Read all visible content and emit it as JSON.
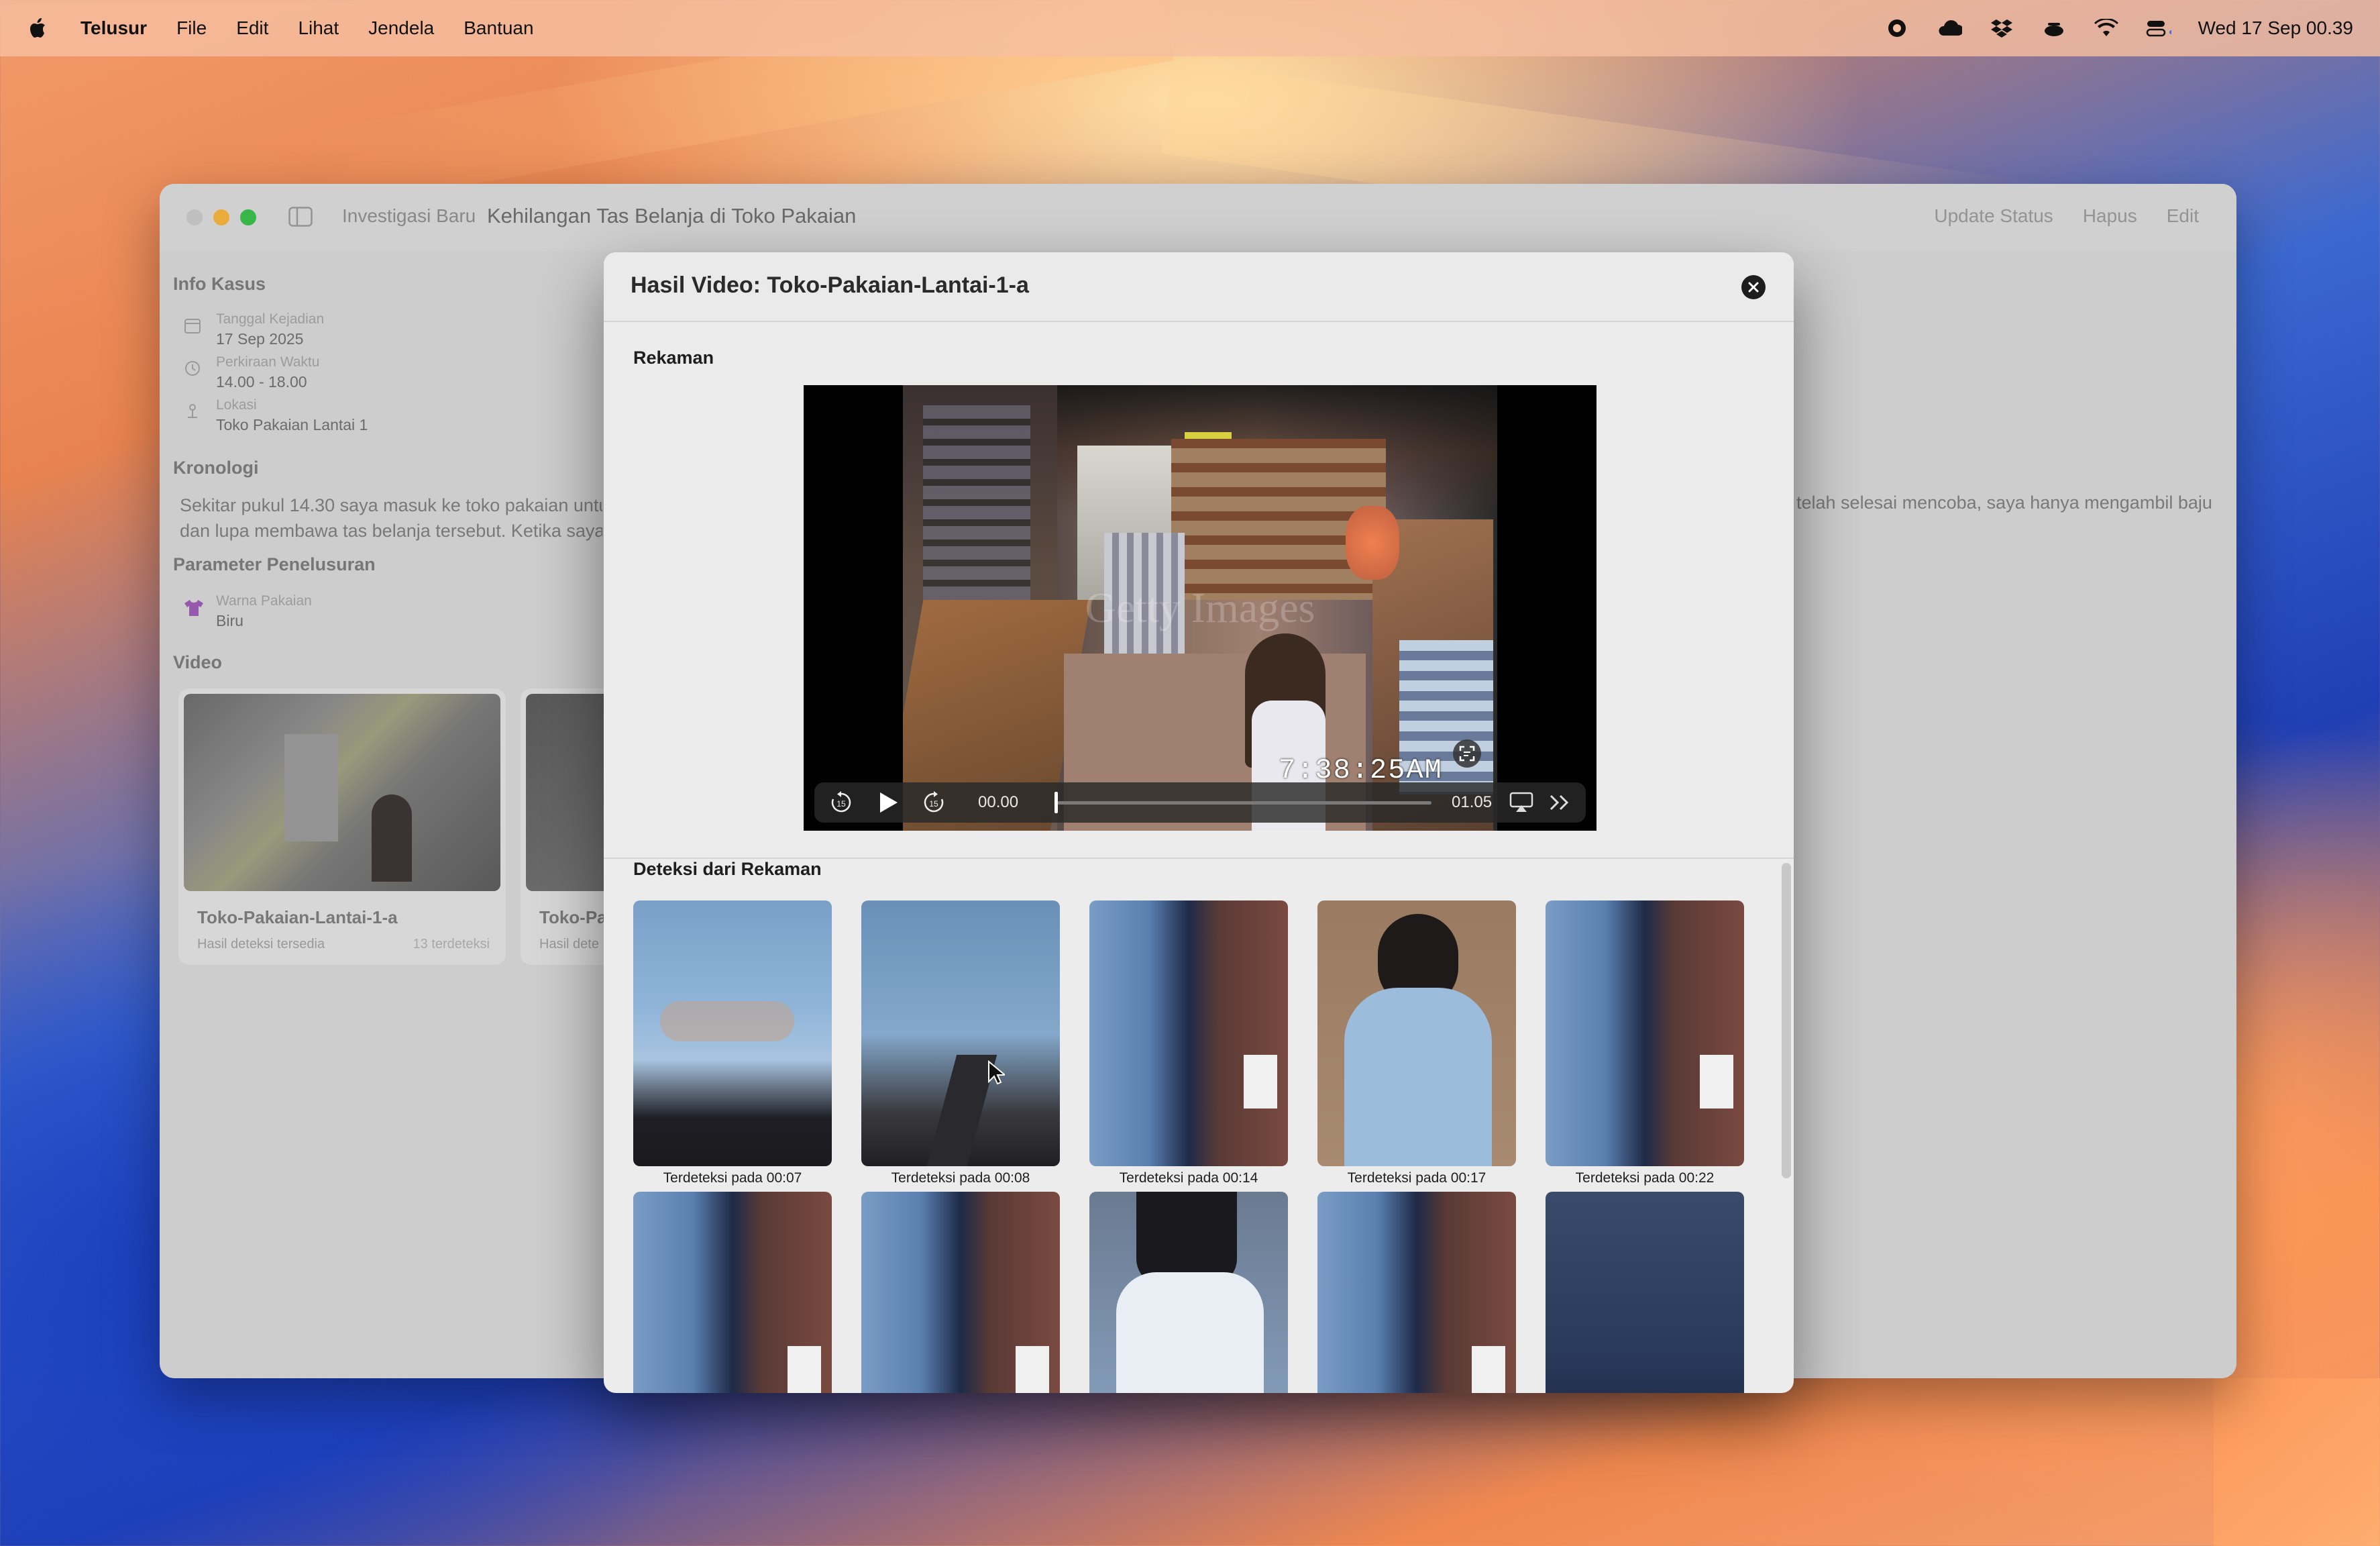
{
  "menubar": {
    "app_name": "Telusur",
    "items": [
      "File",
      "Edit",
      "Lihat",
      "Jendela",
      "Bantuan"
    ],
    "clock": "Wed 17 Sep  00.39"
  },
  "window": {
    "breadcrumb": "Investigasi Baru",
    "title": "Kehilangan Tas Belanja di Toko Pakaian",
    "actions": [
      "Update Status",
      "Hapus",
      "Edit"
    ],
    "info_kasus": {
      "heading": "Info Kasus",
      "rows": [
        {
          "label": "Tanggal Kejadian",
          "value": "17 Sep 2025",
          "icon": "calendar-icon"
        },
        {
          "label": "Perkiraan Waktu",
          "value": "14.00 - 18.00",
          "icon": "clock-icon"
        },
        {
          "label": "Lokasi",
          "value": "Toko Pakaian Lantai 1",
          "icon": "location-pin-icon"
        }
      ]
    },
    "kronologi": {
      "heading": "Kronologi",
      "line1": "Sekitar pukul 14.30 saya masuk ke toko pakaian untuk",
      "line2": "dan lupa membawa tas belanja tersebut. Ketika saya",
      "line1_right": "telah selesai mencoba, saya hanya mengambil baju"
    },
    "parameter": {
      "heading": "Parameter Penelusuran",
      "label": "Warna Pakaian",
      "value": "Biru",
      "icon": "tshirt-icon"
    },
    "video": {
      "heading": "Video",
      "cards": [
        {
          "title": "Toko-Pakaian-Lantai-1-a",
          "subtitle": "Hasil deteksi tersedia",
          "count": "13 terdeteksi"
        },
        {
          "title": "Toko-Pa",
          "subtitle": "Hasil dete"
        }
      ]
    }
  },
  "sheet": {
    "title": "Hasil Video: Toko-Pakaian-Lantai-1-a",
    "rekaman_label": "Rekaman",
    "player": {
      "current_time": "00.00",
      "duration": "01.05",
      "progress": 0.0,
      "overlay_timestamp": "7:38:25AM",
      "watermark": "Getty Images"
    },
    "deteksi_label": "Deteksi dari Rekaman",
    "detections": [
      {
        "caption": "Terdeteksi pada 00:07"
      },
      {
        "caption": "Terdeteksi pada 00:08"
      },
      {
        "caption": "Terdeteksi pada 00:14"
      },
      {
        "caption": "Terdeteksi pada 00:17"
      },
      {
        "caption": "Terdeteksi pada 00:22"
      },
      {
        "caption": ""
      },
      {
        "caption": ""
      },
      {
        "caption": ""
      },
      {
        "caption": ""
      },
      {
        "caption": ""
      }
    ]
  },
  "colors": {
    "accent_dark": "#1d1d1d",
    "sheet_bg": "#ececec",
    "shirt_blue": "#7ea6cf",
    "tshirt_icon": "#9b59b6"
  }
}
